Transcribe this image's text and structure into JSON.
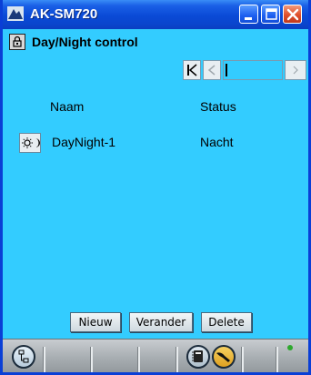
{
  "window": {
    "title": "AK-SM720",
    "titlebar_color": "#0a4ad6",
    "content_bg": "#33ccff"
  },
  "header": {
    "icon": "lock-page-icon",
    "title": "Day/Night control"
  },
  "pager": {
    "icons": [
      "first-page-icon",
      "prev-page-icon",
      "next-page-icon"
    ]
  },
  "table": {
    "columns": [
      "Naam",
      "Status"
    ],
    "rows": [
      {
        "icon": "day-night-icon",
        "name": "DayNight-1",
        "status": "Nacht"
      }
    ]
  },
  "actions": {
    "new_label": "Nieuw",
    "edit_label": "Verander",
    "delete_label": "Delete"
  },
  "statusbar": {
    "icons": [
      "network-tree-icon",
      "notebook-icon",
      "wrench-icon",
      "status-led-icon"
    ],
    "led_color": "#2ea82e"
  }
}
